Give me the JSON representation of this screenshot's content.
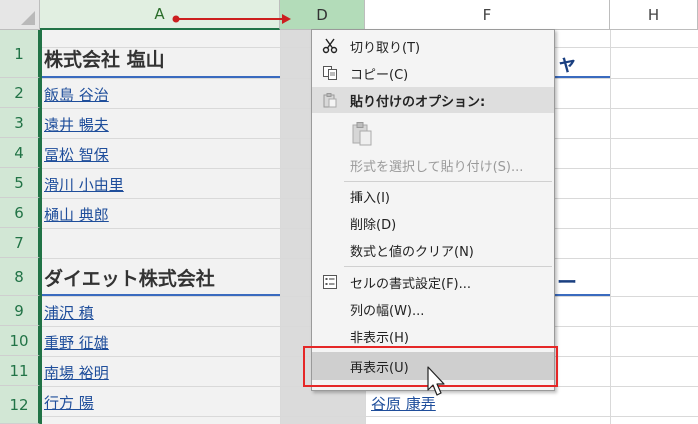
{
  "columns": {
    "A": "A",
    "D": "D",
    "F": "F",
    "H": "H"
  },
  "rows": [
    "1",
    "2",
    "3",
    "4",
    "5",
    "6",
    "7",
    "8",
    "9",
    "10",
    "11",
    "12"
  ],
  "cells": {
    "r1": "株式会社 塩山",
    "r2": "飯島 谷治",
    "r3": "遠井 暢夫",
    "r4": "冨松 智保",
    "r5": "滑川 小由里",
    "r6": "樋山 典郎",
    "r8": "ダイエット株式会社",
    "r9": "浦沢 稹",
    "r10": "重野 征雄",
    "r11": "南場 裕明",
    "r12": "行方 陽"
  },
  "e_cells": {
    "r1_fragment": "ャ",
    "r8_fragment": "ー",
    "r12": "谷原 康弄"
  },
  "context_menu": {
    "cut": "切り取り(T)",
    "copy": "コピー(C)",
    "paste_options": "貼り付けのオプション:",
    "paste_special": "形式を選択して貼り付け(S)...",
    "insert": "挿入(I)",
    "delete": "削除(D)",
    "clear": "数式と値のクリア(N)",
    "format_cells": "セルの書式設定(F)...",
    "column_width": "列の幅(W)...",
    "hide": "非表示(H)",
    "unhide": "再表示(U)"
  },
  "icons": {
    "cut": "scissors-icon",
    "copy": "copy-icon",
    "paste": "paste-icon",
    "paste_large": "paste-large-icon",
    "format": "format-cells-icon"
  },
  "colors": {
    "selection_green": "#217346",
    "link_blue": "#1f4e9b",
    "highlight_red": "#e52727"
  }
}
